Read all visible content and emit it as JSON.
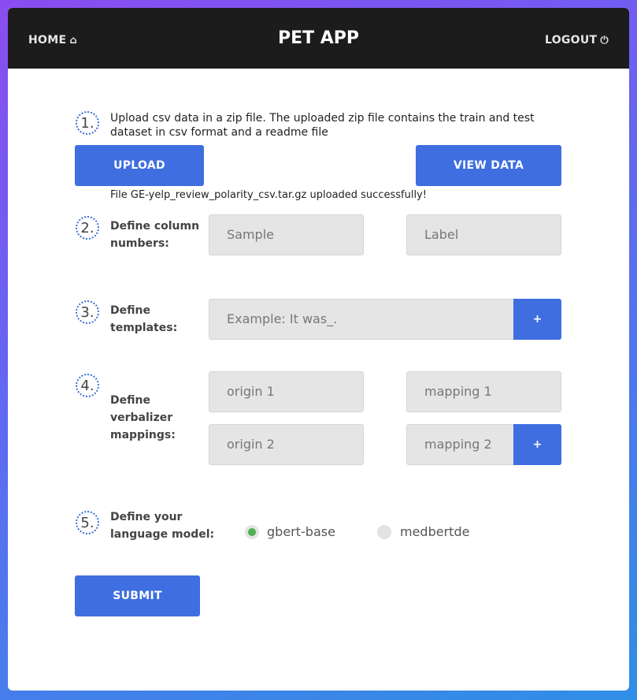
{
  "navbar": {
    "home_label": "HOME",
    "title": "PET APP",
    "logout_label": "LOGOUT",
    "home_icon": "home-icon",
    "logout_icon": "power-icon"
  },
  "steps": {
    "s1": "1.",
    "s2": "2.",
    "s3": "3.",
    "s4": "4.",
    "s5": "5."
  },
  "upload": {
    "description": "Upload csv data in a zip file. The uploaded zip file contains the train and test dataset in csv format and a readme file",
    "upload_label": "UPLOAD",
    "view_label": "VIEW DATA",
    "status": "File GE-yelp_review_polarity_csv.tar.gz uploaded successfully!"
  },
  "columns": {
    "label": "Define column numbers:",
    "sample_placeholder": "Sample",
    "label_placeholder": "Label"
  },
  "templates": {
    "label": "Define templates:",
    "placeholder": "Example: It was_.",
    "add_label": "+"
  },
  "verbalizer": {
    "label": "Define verbalizer mappings:",
    "origin1_placeholder": "origin 1",
    "mapping1_placeholder": "mapping 1",
    "origin2_placeholder": "origin 2",
    "mapping2_placeholder": "mapping 2",
    "add_label": "+"
  },
  "model": {
    "label": "Define your language model:",
    "options": [
      "gbert-base",
      "medbertde"
    ],
    "selected": "gbert-base"
  },
  "submit_label": "SUBMIT",
  "colors": {
    "accent": "#3e6ee0",
    "navbar": "#1c1c1c",
    "radio_selected": "#4caf50"
  }
}
